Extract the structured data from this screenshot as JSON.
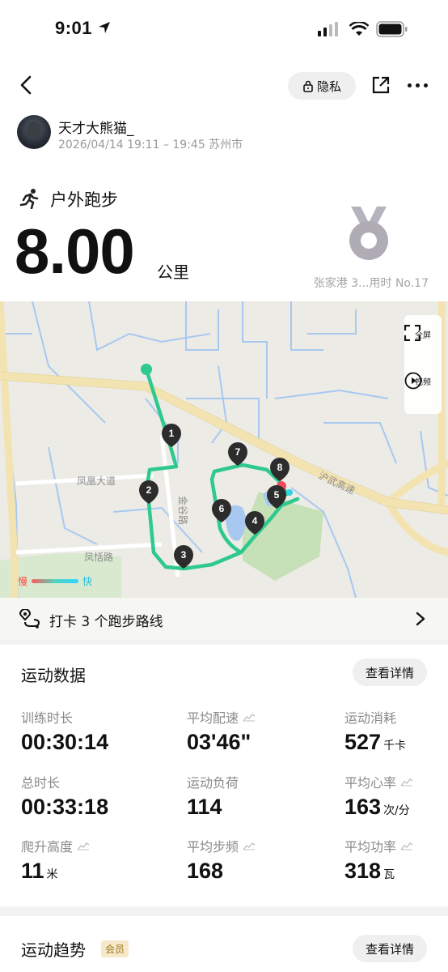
{
  "status_bar": {
    "time": "9:01"
  },
  "nav": {
    "privacy_label": "隐私"
  },
  "user": {
    "name": "天才大熊猫_",
    "time_location": "2026/04/14 19:11 – 19:45 苏州市"
  },
  "activity": {
    "type": "户外跑步",
    "distance": "8.00",
    "distance_unit": "公里",
    "medal_text": "张家港 3...用时 No.17"
  },
  "map": {
    "controls": {
      "fullscreen": "全屏",
      "video": "视频"
    },
    "roads": [
      "凤凰大道",
      "金谷路",
      "凤恬路",
      "沪武高速"
    ],
    "markers": [
      "1",
      "2",
      "3",
      "4",
      "5",
      "6",
      "7",
      "8"
    ],
    "speed_legend": {
      "slow": "慢",
      "fast": "快"
    },
    "colors": {
      "route": "#2ec98e",
      "start": "#2ec98e",
      "end": "#f04a5c",
      "water": "#a8c8f0",
      "park": "#c6e0b7"
    }
  },
  "checkin": {
    "text": "打卡 3 个跑步路线"
  },
  "stats": {
    "title": "运动数据",
    "detail_label": "查看详情",
    "items": [
      {
        "label": "训练时长",
        "value": "00:30:14",
        "unit": ""
      },
      {
        "label": "平均配速",
        "value": "03'46\"",
        "unit": ""
      },
      {
        "label": "运动消耗",
        "value": "527",
        "unit": "千卡"
      },
      {
        "label": "总时长",
        "value": "00:33:18",
        "unit": ""
      },
      {
        "label": "运动负荷",
        "value": "114",
        "unit": ""
      },
      {
        "label": "平均心率",
        "value": "163",
        "unit": "次/分"
      },
      {
        "label": "爬升高度",
        "value": "11",
        "unit": "米"
      },
      {
        "label": "平均步频",
        "value": "168",
        "unit": ""
      },
      {
        "label": "平均功率",
        "value": "318",
        "unit": "瓦"
      }
    ]
  },
  "trend": {
    "title": "运动趋势",
    "badge": "会员",
    "detail_label": "查看详情"
  },
  "colors": {
    "accent_gray": "#efefef",
    "text_secondary": "#8a8a8a"
  }
}
